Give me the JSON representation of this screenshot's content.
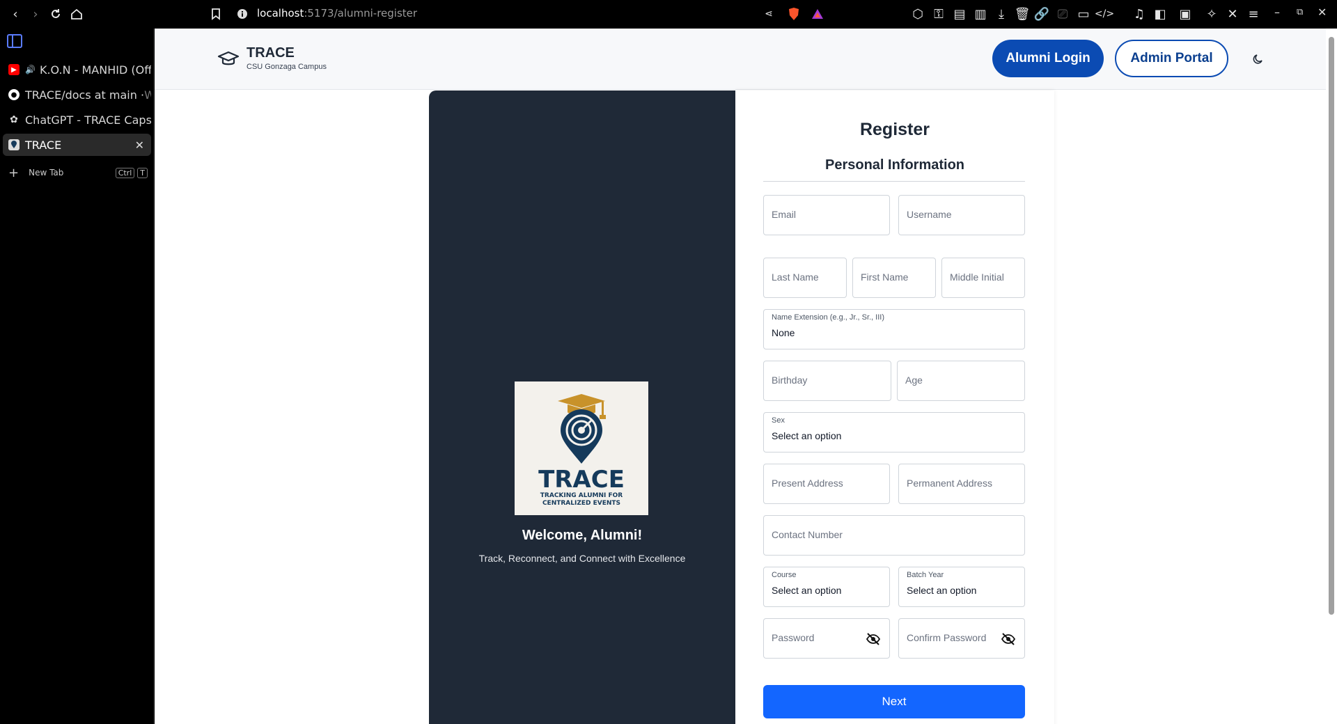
{
  "browser": {
    "url_host": "localhost",
    "url_path": ":5173/alumni-register"
  },
  "sidebar": {
    "tabs": [
      {
        "label": "K.O.N - MANHID (Off",
        "fade": "",
        "icon": "youtube-icon"
      },
      {
        "label": "TRACE/docs at main · ",
        "fade": "W",
        "icon": "github-icon"
      },
      {
        "label": "ChatGPT - TRACE Caps",
        "fade": "t",
        "icon": "openai-icon"
      },
      {
        "label": "TRACE",
        "fade": "",
        "icon": "trace-favicon"
      }
    ],
    "new_tab": {
      "label": "New Tab",
      "key1": "Ctrl",
      "key2": "T"
    }
  },
  "navbar": {
    "brand_title": "TRACE",
    "brand_subtitle": "CSU Gonzaga Campus",
    "login_label": "Alumni Login",
    "admin_label": "Admin Portal",
    "theme_icon": "moon-icon"
  },
  "hero": {
    "logo_title": "TRACE",
    "logo_line1": "TRACKING ALUMNI FOR",
    "logo_line2": "CENTRALIZED EVENTS",
    "welcome": "Welcome, Alumni!",
    "tagline": "Track, Reconnect, and Connect with Excellence"
  },
  "form": {
    "title": "Register",
    "section": "Personal Information",
    "email_ph": "Email",
    "username_ph": "Username",
    "last_name_ph": "Last Name",
    "first_name_ph": "First Name",
    "middle_initial_ph": "Middle Initial",
    "name_ext_label": "Name Extension (e.g., Jr., Sr., III)",
    "name_ext_value": "None",
    "birthday_ph": "Birthday",
    "age_ph": "Age",
    "sex_label": "Sex",
    "sex_value": "Select an option",
    "present_address_ph": "Present Address",
    "permanent_address_ph": "Permanent Address",
    "contact_ph": "Contact Number",
    "course_label": "Course",
    "course_value": "Select an option",
    "batch_label": "Batch Year",
    "batch_value": "Select an option",
    "password_ph": "Password",
    "confirm_password_ph": "Confirm Password",
    "next_label": "Next"
  },
  "colors": {
    "primary": "#0b4bb3",
    "next_button": "#1366ff",
    "dark_panel": "#1f2937",
    "logo_gold": "#c8922a",
    "logo_navy": "#153a5b"
  }
}
